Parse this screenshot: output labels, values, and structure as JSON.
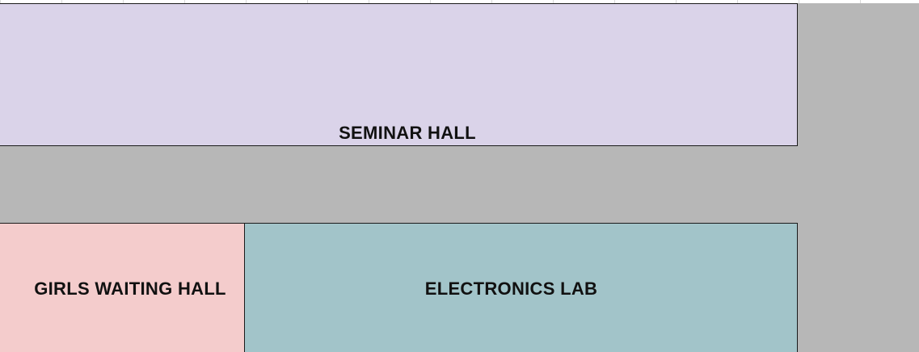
{
  "floor_plan": {
    "rooms": [
      {
        "id": "seminar_hall",
        "label": "SEMINAR HALL",
        "color": "#dad3e9"
      },
      {
        "id": "girls_waiting_hall",
        "label": "GIRLS WAITING HALL",
        "color": "#f4cccc"
      },
      {
        "id": "electronics_lab",
        "label": "ELECTRONICS LAB",
        "color": "#a2c4c9"
      }
    ],
    "corridor_color": "#b7b7b7",
    "border_color": "#1a1a1a"
  }
}
